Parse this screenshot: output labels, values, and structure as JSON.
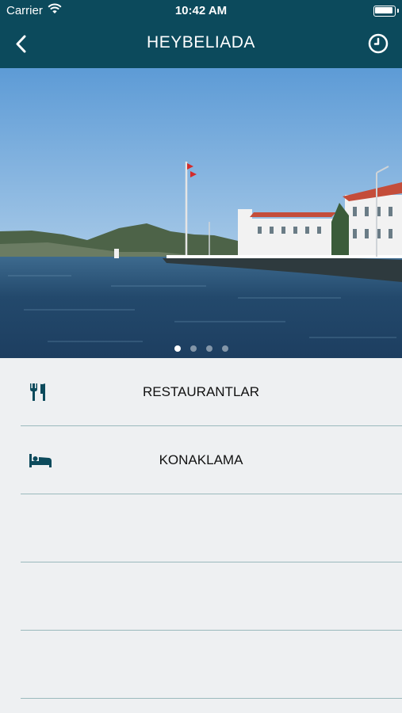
{
  "status_bar": {
    "carrier": "Carrier",
    "time": "10:42 AM"
  },
  "header": {
    "title": "HEYBELIADA",
    "back_icon": "chevron-left-icon",
    "history_icon": "clock-icon"
  },
  "hero": {
    "slide_count": 4,
    "active_slide": 1
  },
  "menu": {
    "items": [
      {
        "label": "RESTAURANTLAR",
        "icon": "fork-knife-icon"
      },
      {
        "label": "KONAKLAMA",
        "icon": "bed-icon"
      },
      {
        "label": ""
      },
      {
        "label": ""
      },
      {
        "label": ""
      }
    ]
  },
  "colors": {
    "header_bg": "#0c4a5c",
    "list_bg": "#eef0f2",
    "separator": "#9ab9bd",
    "icon": "#0c4a5c"
  }
}
